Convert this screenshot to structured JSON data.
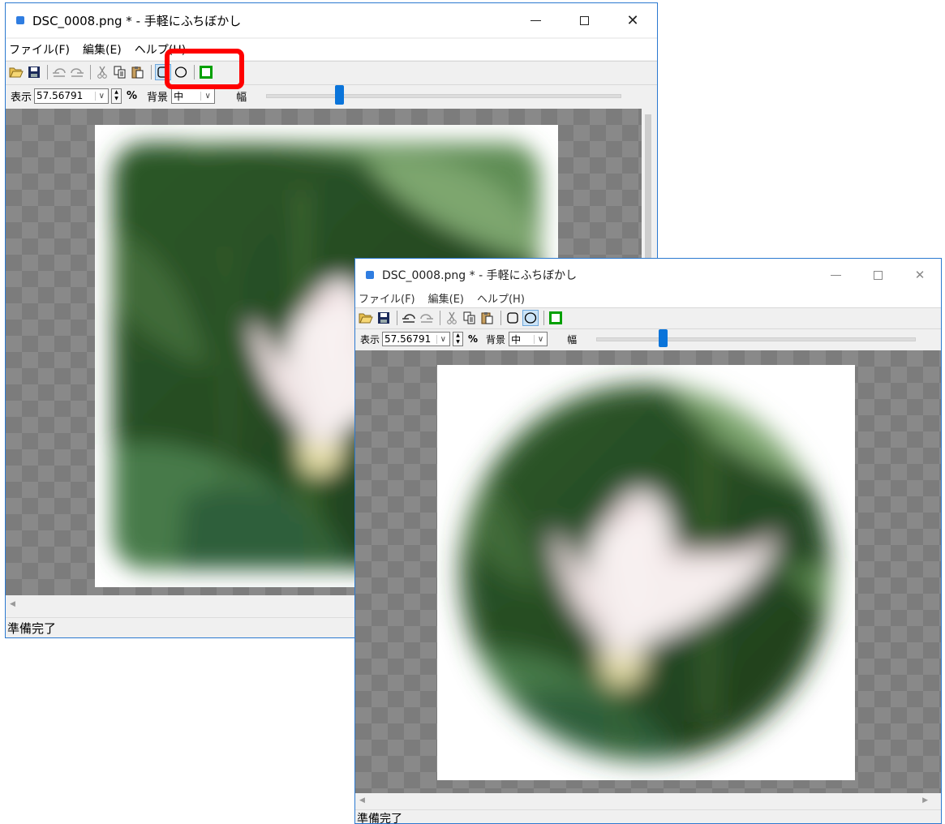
{
  "window": {
    "title": "DSC_0008.png * - 手軽にふちぼかし",
    "menus": [
      "ファイル(F)",
      "編集(E)",
      "ヘルプ(H)"
    ],
    "viewbar": {
      "display_label": "表示",
      "zoom_value": "57.567913",
      "zoom_display": "57.56791",
      "percent_label": "%",
      "background_label": "背景",
      "background_value": "中",
      "width_label": "幅"
    },
    "status": "準備完了",
    "caption_buttons": {
      "close": "✕"
    }
  },
  "toolbar_icons": [
    "open-folder-icon",
    "save-icon",
    "undo-icon",
    "redo-icon",
    "cut-icon",
    "copy-icon",
    "paste-icon",
    "rect-shape-icon",
    "ellipse-shape-icon",
    "frame-color-icon"
  ],
  "window1": {
    "selected_shape": "rectangle",
    "slider_fraction": 0.21
  },
  "window2": {
    "selected_shape": "ellipse",
    "slider_fraction": 0.21
  },
  "colors": {
    "accent": "#0a74da",
    "highlight": "#ff0000",
    "frame_green": "#00a000"
  }
}
